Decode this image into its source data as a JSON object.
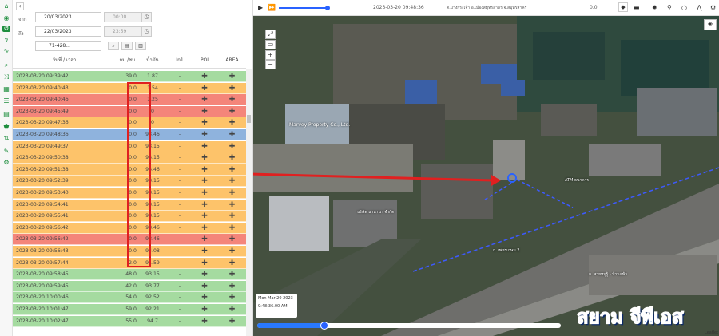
{
  "filters": {
    "from_label": "จาก",
    "to_label": "ถึง",
    "from_date": "20/03/2023",
    "from_time": "00:00",
    "to_date": "22/03/2023",
    "to_time": "23:59",
    "vehicle": "71-428..."
  },
  "table": {
    "columns": [
      "วันที่ / เวลา",
      "กม./ชม.",
      "น้ำมัน",
      "In1",
      "POI",
      "AREA"
    ],
    "plus_glyph": "✚",
    "dash": "-",
    "rows": [
      {
        "dt": "2023-03-20 09:39:42",
        "speed": "39.0",
        "fuel": "1.87",
        "status": "green"
      },
      {
        "dt": "2023-03-20 09:40:43",
        "speed": "0.0",
        "fuel": "1.54",
        "status": "orange"
      },
      {
        "dt": "2023-03-20 09:40:46",
        "speed": "0.0",
        "fuel": "1.25",
        "status": "red"
      },
      {
        "dt": "2023-03-20 09:45:49",
        "speed": "0.0",
        "fuel": "0",
        "status": "red"
      },
      {
        "dt": "2023-03-20 09:47:36",
        "speed": "0.0",
        "fuel": "0",
        "status": "orange"
      },
      {
        "dt": "2023-03-20 09:48:36",
        "speed": "0.0",
        "fuel": "93.46",
        "status": "blue"
      },
      {
        "dt": "2023-03-20 09:49:37",
        "speed": "0.0",
        "fuel": "93.15",
        "status": "orange"
      },
      {
        "dt": "2023-03-20 09:50:38",
        "speed": "0.0",
        "fuel": "93.15",
        "status": "orange"
      },
      {
        "dt": "2023-03-20 09:51:38",
        "speed": "0.0",
        "fuel": "93.46",
        "status": "orange"
      },
      {
        "dt": "2023-03-20 09:52:39",
        "speed": "0.0",
        "fuel": "93.15",
        "status": "orange"
      },
      {
        "dt": "2023-03-20 09:53:40",
        "speed": "0.0",
        "fuel": "93.15",
        "status": "orange"
      },
      {
        "dt": "2023-03-20 09:54:41",
        "speed": "0.0",
        "fuel": "93.15",
        "status": "orange"
      },
      {
        "dt": "2023-03-20 09:55:41",
        "speed": "0.0",
        "fuel": "93.15",
        "status": "orange"
      },
      {
        "dt": "2023-03-20 09:56:42",
        "speed": "0.0",
        "fuel": "93.46",
        "status": "orange"
      },
      {
        "dt": "2023-03-20 09:56:42",
        "speed": "0.0",
        "fuel": "93.46",
        "status": "red"
      },
      {
        "dt": "2023-03-20 09:56:43",
        "speed": "0.0",
        "fuel": "94.08",
        "status": "orange"
      },
      {
        "dt": "2023-03-20 09:57:44",
        "speed": "2.0",
        "fuel": "91.59",
        "status": "orange"
      },
      {
        "dt": "2023-03-20 09:58:45",
        "speed": "48.0",
        "fuel": "93.15",
        "status": "green"
      },
      {
        "dt": "2023-03-20 09:59:45",
        "speed": "42.0",
        "fuel": "93.77",
        "status": "green"
      },
      {
        "dt": "2023-03-20 10:00:46",
        "speed": "54.0",
        "fuel": "92.52",
        "status": "green"
      },
      {
        "dt": "2023-03-20 10:01:47",
        "speed": "59.0",
        "fuel": "92.21",
        "status": "green"
      },
      {
        "dt": "2023-03-20 10:02:47",
        "speed": "55.0",
        "fuel": "94.7",
        "status": "green"
      }
    ]
  },
  "playback": {
    "datetime": "2023-03-20 09:48:36",
    "location": "ต.บางกระเจ้า อ.เมืองสมุทรสาคร จ.สมุทรสาคร",
    "speed": "0.0"
  },
  "map": {
    "timebox_date": "Mon Mar 20 2023",
    "timebox_time": "9:48:36.00 AM",
    "watermark": "สยาม จีพีเอส",
    "labels": [
      {
        "text": "Marvey Property Co., Ltd."
      },
      {
        "text": "ATM ธนาคาร"
      },
      {
        "text": "บริษัท นานานา จำกัด"
      },
      {
        "text": "ถ. เพชรเกษม 2"
      },
      {
        "text": "ถ. สายหมูรู้ - บ้านแพ้ว"
      },
      {
        "text": "Leaflet"
      }
    ],
    "zoom_in": "+",
    "zoom_out": "−"
  },
  "colors": {
    "green": "#a5dba0",
    "orange": "#fdc36a",
    "red": "#f4857a",
    "blue": "#8fb3dd",
    "accent": "#2962ff"
  }
}
